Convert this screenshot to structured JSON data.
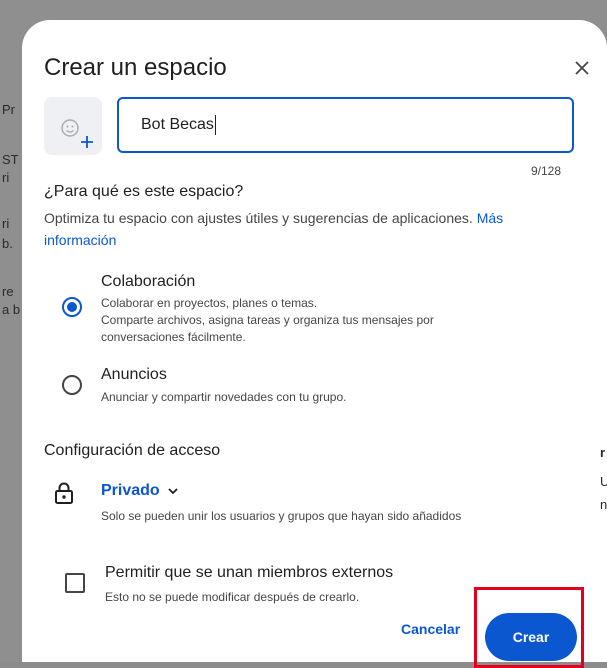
{
  "background": {
    "fragments": [
      "Pr",
      "ST",
      "ri",
      "ri",
      "b.",
      "re",
      "a b",
      "r",
      "U",
      "n"
    ]
  },
  "dialog": {
    "title": "Crear un espacio",
    "close_icon": "close-icon",
    "emoji_icon": "add-emoji-icon",
    "name_input": {
      "value": "Bot Becas",
      "counter": "9/128"
    },
    "purpose": {
      "title": "¿Para qué es este espacio?",
      "description": "Optimiza tu espacio con ajustes útiles y sugerencias de aplicaciones. ",
      "link": "Más información",
      "options": [
        {
          "label": "Colaboración",
          "description": "Colaborar en proyectos, planes o temas.\nComparte archivos, asigna tareas y organiza tus mensajes por conversaciones fácilmente.",
          "selected": true
        },
        {
          "label": "Anuncios",
          "description": "Anunciar y compartir novedades con tu grupo.",
          "selected": false
        }
      ]
    },
    "access": {
      "title": "Configuración de acceso",
      "lock_icon": "lock-icon",
      "privacy_label": "Privado",
      "privacy_description": "Solo se pueden unir los usuarios y grupos que hayan sido añadidos",
      "external": {
        "label": "Permitir que se unan miembros externos",
        "description": "Esto no se puede modificar después de crearlo.",
        "checked": false
      }
    },
    "actions": {
      "cancel_label": "Cancelar",
      "create_label": "Crear"
    }
  },
  "colors": {
    "accent": "#0b57d0",
    "highlight": "#e4001d",
    "backdrop": "#8f8f8f"
  }
}
